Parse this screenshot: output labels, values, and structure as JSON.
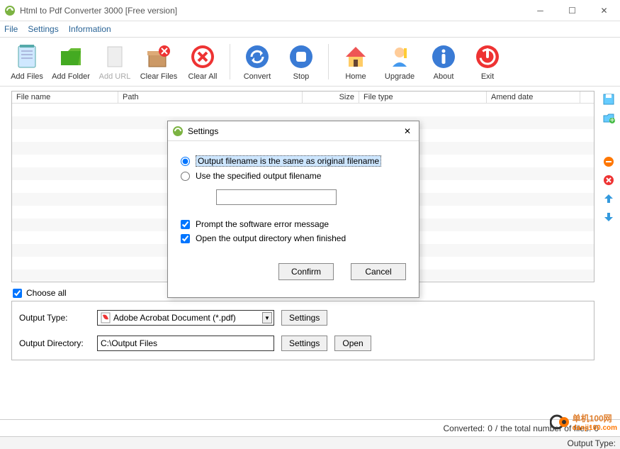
{
  "window": {
    "title": "Html to Pdf Converter 3000 [Free version]"
  },
  "menu": {
    "file": "File",
    "settings": "Settings",
    "information": "Information"
  },
  "toolbar": {
    "addfiles": "Add Files",
    "addfolder": "Add Folder",
    "addurl": "Add URL",
    "clearfiles": "Clear Files",
    "clearall": "Clear All",
    "convert": "Convert",
    "stop": "Stop",
    "home": "Home",
    "upgrade": "Upgrade",
    "about": "About",
    "exit": "Exit"
  },
  "table": {
    "columns": [
      "File name",
      "Path",
      "Size",
      "File type",
      "Amend date"
    ]
  },
  "choose_all": "Choose all",
  "output": {
    "type_label": "Output Type:",
    "type_value": "Adobe Acrobat Document (*.pdf)",
    "dir_label": "Output Directory:",
    "dir_value": "C:\\Output Files",
    "settings": "Settings",
    "open": "Open"
  },
  "status": {
    "converted_label": "Converted:",
    "converted_value": "0",
    "sep": "/",
    "total_label": "the total number of files:",
    "total_value": "0",
    "output_type_label": "Output Type:"
  },
  "dialog": {
    "title": "Settings",
    "opt1": "Output filename is the same as original filename",
    "opt2": "Use the specified output filename",
    "specified_value": "",
    "chk1": "Prompt the software error message",
    "chk2": "Open the output directory when finished",
    "confirm": "Confirm",
    "cancel": "Cancel"
  },
  "watermark": {
    "brand": "单机100网",
    "url": "danji100.com"
  }
}
